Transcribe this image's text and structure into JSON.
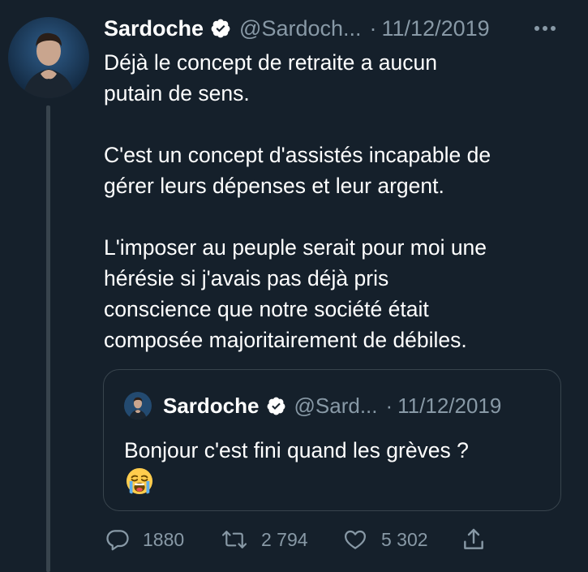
{
  "tweet": {
    "author_name": "Sardoche",
    "handle": "@Sardoch...",
    "separator": "·",
    "date": "11/12/2019",
    "text_lines": [
      "Déjà le concept de retraite a aucun",
      "putain de sens.",
      "",
      "C'est un concept d'assistés incapable de",
      "gérer leurs dépenses et leur argent.",
      "",
      "L'imposer au peuple serait pour moi une",
      "hérésie si j'avais pas déjà pris",
      "conscience que notre société était",
      "composée majoritairement de débiles."
    ]
  },
  "quoted_tweet": {
    "author_name": "Sardoche",
    "handle": "@Sard...",
    "separator": "·",
    "date": "11/12/2019",
    "text": "Bonjour c'est fini quand les grèves ?",
    "emoji": "loudly-crying-face"
  },
  "actions": {
    "reply_count": "1880",
    "retweet_count": "2 794",
    "like_count": "5 302"
  },
  "icons": {
    "verified": "verified-badge-icon",
    "more": "more-options-icon",
    "reply": "reply-icon",
    "retweet": "retweet-icon",
    "like": "heart-icon",
    "share": "share-icon"
  },
  "colors": {
    "background": "#15202b",
    "secondary_text": "#8899a6",
    "border": "#38444d",
    "primary_text": "#ffffff"
  }
}
